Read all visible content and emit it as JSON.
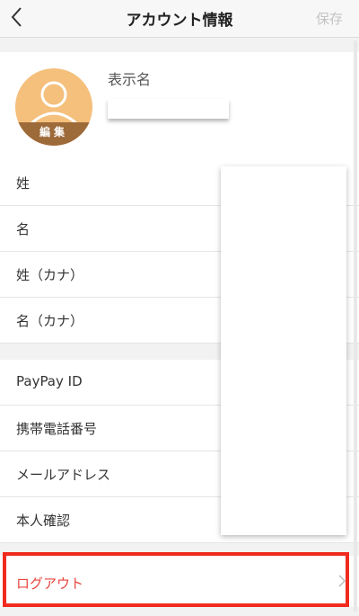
{
  "header": {
    "title": "アカウント情報",
    "save_label": "保存"
  },
  "profile": {
    "edit_label": "編集",
    "display_name_label": "表示名",
    "display_name_value": ""
  },
  "name_fields": [
    {
      "label": "姓"
    },
    {
      "label": "名"
    },
    {
      "label": "姓（カナ）"
    },
    {
      "label": "名（カナ）"
    }
  ],
  "account_fields": [
    {
      "label": "PayPay ID"
    },
    {
      "label": "携帯電話番号"
    },
    {
      "label": "メールアドレス"
    },
    {
      "label": "本人確認"
    }
  ],
  "logout": {
    "label": "ログアウト"
  },
  "colors": {
    "avatar_bg": "#f5bf7c",
    "avatar_edit_bg": "#9d6a3a",
    "logout_text": "#e8453c",
    "highlight": "#f02b1e"
  },
  "icons": {
    "back": "chevron-left-icon",
    "avatar": "user-icon",
    "logout": "chevron-right-icon"
  }
}
